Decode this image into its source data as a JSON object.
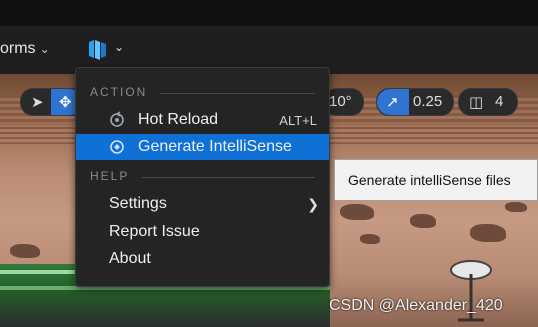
{
  "toolbar": {
    "platforms_label": "orms",
    "platforms_chevron": "chevron-down-icon",
    "ue_button_icon": "unreal-visual-studio-icon",
    "ue_button_chevron": "chevron-down-icon"
  },
  "viewport": {
    "rotation_value": "10°",
    "scale_value": "0.25",
    "camera_speed": "4"
  },
  "menu": {
    "sections": [
      {
        "title": "ACTION",
        "items": [
          {
            "label": "Hot Reload",
            "shortcut": "ALT+L",
            "icon": "hot-reload-icon"
          },
          {
            "label": "Generate IntelliSense",
            "shortcut": "",
            "icon": "generate-intellisense-icon",
            "highlighted": true
          }
        ]
      },
      {
        "title": "HELP",
        "items": [
          {
            "label": "Settings",
            "has_submenu": true
          },
          {
            "label": "Report Issue"
          },
          {
            "label": "About"
          }
        ]
      }
    ]
  },
  "tooltip": {
    "text": "Generate intelliSense files"
  },
  "watermark": "CSDN @Alexander_420",
  "colors": {
    "highlight": "#0f70d6",
    "menu_bg": "#242424",
    "tooltip_bg": "#f2f2f2"
  }
}
